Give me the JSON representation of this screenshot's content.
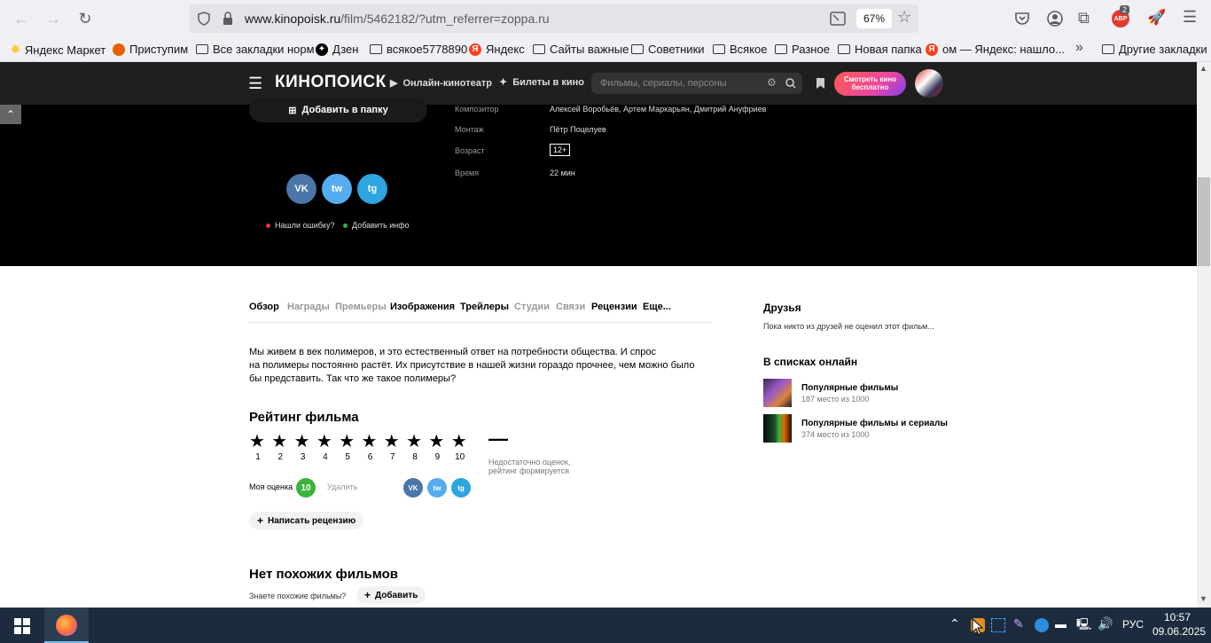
{
  "browser": {
    "url_host": "www.kinopoisk.ru",
    "url_path": "/film/5462182/?utm_referrer=zoppa.ru",
    "zoom": "67%",
    "ext_badge": "2",
    "ext_label": "ABP"
  },
  "bookmarks": [
    "Яндекс Маркет",
    "Приступим",
    "Все закладки норм",
    "Дзен",
    "всякое5778890",
    "Яндекс",
    "Сайты важные",
    "Советники",
    "Всякое",
    "Разное",
    "Новая папка",
    "ом — Яндекс: нашло...",
    "Другие закладки"
  ],
  "header": {
    "logo": "КИНОПОИСК",
    "online": "Онлайн-кинотеатр",
    "tickets": "Билеты в кино",
    "search_placeholder": "Фильмы, сериалы, персоны",
    "watch_free_line1": "Смотреть кино",
    "watch_free_line2": "бесплатно"
  },
  "film": {
    "add_folder": "Добавить в папку",
    "details": [
      {
        "label": "Композитор",
        "value": "Алексей Воробьёв, Артем Маркарьян, Дмитрий Ануфриев"
      },
      {
        "label": "Монтаж",
        "value": "Пётр Поцелуев"
      },
      {
        "label": "Возраст",
        "value": "12+"
      },
      {
        "label": "Время",
        "value": "22 мин"
      }
    ],
    "social": {
      "vk": "VK",
      "tw": "tw",
      "tg": "tg"
    },
    "found_error": "Нашли ошибку?",
    "add_info": "Добавить инфо"
  },
  "tabs": [
    "Обзор",
    "Награды",
    "Премьеры",
    "Изображения",
    "Трейлеры",
    "Студии",
    "Связи",
    "Рецензии",
    "Еще..."
  ],
  "description": [
    "Мы живем в век полимеров, и это естественный ответ на потребности общества. И спрос",
    "на полимеры постоянно растёт. Их присутствие в нашей жизни гораздо прочнее, чем можно было",
    "бы представить. Так что же такое полимеры?"
  ],
  "rating": {
    "title": "Рейтинг фильма",
    "stars": [
      "1",
      "2",
      "3",
      "4",
      "5",
      "6",
      "7",
      "8",
      "9",
      "10"
    ],
    "value": "—",
    "note_line1": "Недостаточно оценок,",
    "note_line2": "рейтинг формируется",
    "my_label": "Моя оценка",
    "my_value": "10",
    "delete": "Удалить",
    "write_review": "Написать рецензию"
  },
  "similar": {
    "title": "Нет похожих фильмов",
    "question": "Знаете похожие фильмы?",
    "add": "Добавить"
  },
  "sidebar": {
    "friends_title": "Друзья",
    "friends_text": "Пока никто из друзей не оценил этот фильм...",
    "lists_title": "В списках онлайн",
    "lists": [
      {
        "title": "Популярные фильмы",
        "sub": "187 место из 1000"
      },
      {
        "title": "Популярные фильмы и сериалы",
        "sub": "374 место из 1000"
      }
    ]
  },
  "taskbar": {
    "lang": "РУС",
    "time": "10:57",
    "date": "09.06.2025"
  },
  "colors": {
    "accent_gradient_start": "#ff5c4d",
    "accent_gradient_end": "#8f32ff",
    "green": "#3bb33b",
    "vk": "#4a76a8",
    "twitter": "#55acee",
    "telegram": "#2ca5e0"
  }
}
